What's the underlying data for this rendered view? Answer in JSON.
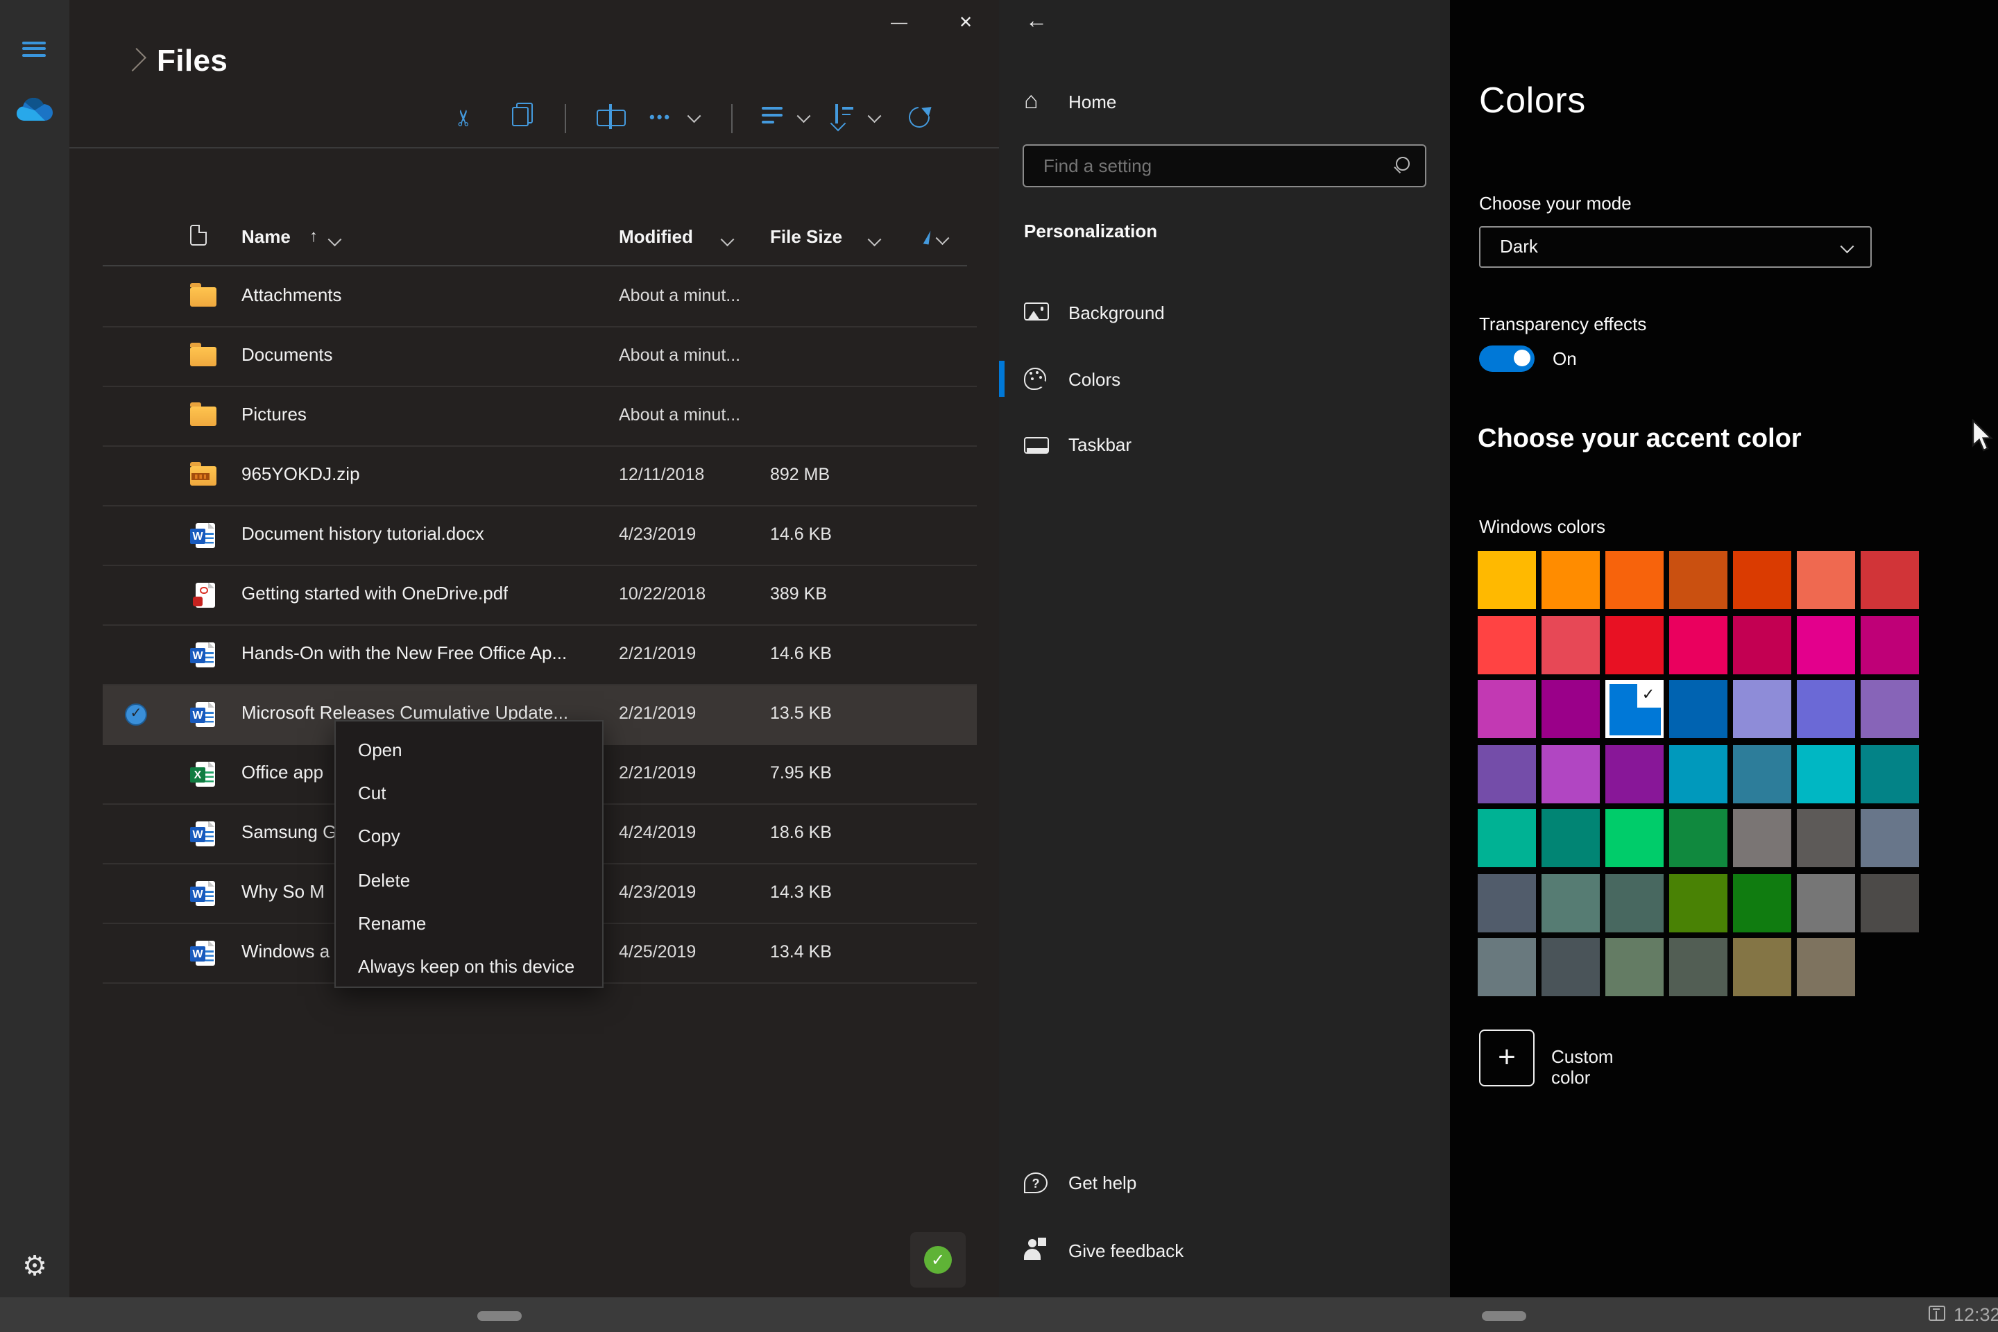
{
  "files_app": {
    "title": "Files",
    "window_controls": {
      "minimize": "—",
      "close": "✕"
    },
    "sidebar_icons": [
      "menu-icon",
      "onedrive-cloud-icon",
      "settings-gear-icon"
    ],
    "toolbar_icons": [
      "cut-icon",
      "copy-icon",
      "rename-icon",
      "more-ellipsis-icon",
      "view-options-icon",
      "sort-order-icon",
      "refresh-icon"
    ],
    "table": {
      "columns": [
        {
          "label": "Name",
          "sort": "asc"
        },
        {
          "label": "Modified"
        },
        {
          "label": "File Size"
        }
      ],
      "rows": [
        {
          "type": "folder",
          "name": "Attachments",
          "modified": "About a minut...",
          "size": "",
          "selected": false
        },
        {
          "type": "folder",
          "name": "Documents",
          "modified": "About a minut...",
          "size": "",
          "selected": false
        },
        {
          "type": "folder",
          "name": "Pictures",
          "modified": "About a minut...",
          "size": "",
          "selected": false
        },
        {
          "type": "zip",
          "name": "965YOKDJ.zip",
          "modified": "12/11/2018",
          "size": "892 MB",
          "selected": false
        },
        {
          "type": "word",
          "name": "Document history tutorial.docx",
          "modified": "4/23/2019",
          "size": "14.6 KB",
          "selected": false
        },
        {
          "type": "pdf",
          "name": "Getting started with OneDrive.pdf",
          "modified": "10/22/2018",
          "size": "389 KB",
          "selected": false
        },
        {
          "type": "word",
          "name": "Hands-On with the New Free Office Ap...",
          "modified": "2/21/2019",
          "size": "14.6 KB",
          "selected": false
        },
        {
          "type": "word",
          "name": "Microsoft Releases Cumulative Update...",
          "modified": "2/21/2019",
          "size": "13.5 KB",
          "selected": true
        },
        {
          "type": "excel",
          "name": "Office app",
          "modified": "2/21/2019",
          "size": "7.95 KB",
          "selected": false
        },
        {
          "type": "word",
          "name": "Samsung G",
          "modified": "4/24/2019",
          "size": "18.6 KB",
          "selected": false
        },
        {
          "type": "word",
          "name": "Why So M",
          "modified": "4/23/2019",
          "size": "14.3 KB",
          "selected": false
        },
        {
          "type": "word",
          "name": "Windows a",
          "modified": "4/25/2019",
          "size": "13.4 KB",
          "selected": false
        }
      ]
    },
    "sync_status": "up-to-date-check"
  },
  "context_menu": {
    "items": [
      "Open",
      "Cut",
      "Copy",
      "Delete",
      "Rename",
      "Always keep on this device"
    ]
  },
  "settings_app": {
    "window_controls": {
      "minimize": "—",
      "close": "✕"
    },
    "nav": {
      "back_icon": "←",
      "home_label": "Home",
      "search_placeholder": "Find a setting",
      "section_heading": "Personalization",
      "items": [
        {
          "label": "Background",
          "icon": "background-image-icon",
          "selected": false
        },
        {
          "label": "Colors",
          "icon": "palette-icon",
          "selected": true
        },
        {
          "label": "Taskbar",
          "icon": "taskbar-icon",
          "selected": false
        }
      ],
      "footer_items": [
        {
          "label": "Get help",
          "icon": "help-chat-icon"
        },
        {
          "label": "Give feedback",
          "icon": "feedback-person-icon"
        }
      ]
    },
    "colors_page": {
      "title": "Colors",
      "mode_label": "Choose your mode",
      "mode_value": "Dark",
      "transparency_label": "Transparency effects",
      "transparency_state": "On",
      "accent_heading": "Choose your accent color",
      "windows_colors_label": "Windows colors",
      "accent_color": "#0078D7",
      "selected_index": 16,
      "swatches": [
        "#FFB900",
        "#FF8C00",
        "#F7630C",
        "#CA5010",
        "#DA3B01",
        "#EF6950",
        "#D13438",
        "#FF4343",
        "#E74856",
        "#E81123",
        "#EA005E",
        "#C30052",
        "#E3008C",
        "#BF0077",
        "#C239B3",
        "#9A0089",
        "#0078D7",
        "#0063B1",
        "#8E8CD8",
        "#6B69D6",
        "#8764B8",
        "#744DA9",
        "#B146C2",
        "#881798",
        "#0099BC",
        "#2D7D9A",
        "#00B7C3",
        "#038387",
        "#00B294",
        "#018574",
        "#00CC6A",
        "#10893E",
        "#7A7574",
        "#5D5A58",
        "#68768A",
        "#515C6B",
        "#567C73",
        "#486860",
        "#498205",
        "#107C10",
        "#767676",
        "#4C4A48",
        "#69797E",
        "#4A5459",
        "#647C64",
        "#525E54",
        "#847545",
        "#7E735F"
      ],
      "custom_color_label": "Custom color",
      "custom_plus": "+"
    }
  },
  "system_taskbar": {
    "time": "12:32",
    "dock_icon": "docked-device-icon"
  }
}
